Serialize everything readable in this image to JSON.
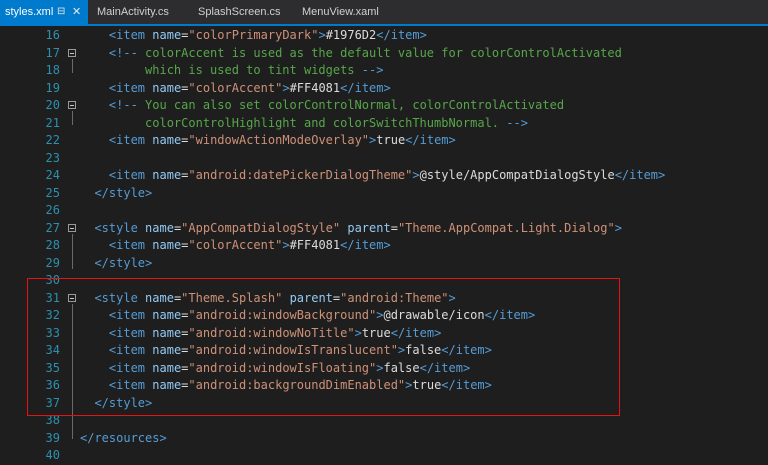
{
  "tabs": [
    {
      "label": "styles.xml",
      "active": true,
      "pin_glyph": "⊟",
      "close_glyph": "✕"
    },
    {
      "label": "MainActivity.cs",
      "active": false
    },
    {
      "label": "SplashScreen.cs",
      "active": false
    },
    {
      "label": "MenuView.xaml",
      "active": false
    }
  ],
  "colors": {
    "background": "#1e1e1e",
    "tab_active": "#007acc",
    "line_number": "#2b91af",
    "tag": "#569cd6",
    "attribute": "#92caf4",
    "value": "#ce9178",
    "comment": "#57a64a",
    "text": "#dcdcdc",
    "highlight_border": "#e51414"
  },
  "editor": {
    "lines": [
      {
        "num": "16",
        "fold": false,
        "tokens": [
          [
            "t",
            "    "
          ],
          [
            "p",
            "<item "
          ],
          [
            "a",
            "name"
          ],
          [
            "t",
            "="
          ],
          [
            "s",
            "\"colorPrimaryDark\""
          ],
          [
            "p",
            ">"
          ],
          [
            "t",
            "#1976D2"
          ],
          [
            "p",
            "</item>"
          ]
        ]
      },
      {
        "num": "17",
        "fold": true,
        "tokens": [
          [
            "t",
            "    "
          ],
          [
            "p",
            "<!-- "
          ],
          [
            "c",
            "colorAccent is used as the default value for colorControlActivated"
          ]
        ]
      },
      {
        "num": "18",
        "fold": false,
        "tokens": [
          [
            "c",
            "         which is used to tint widgets "
          ],
          [
            "p",
            "-->"
          ]
        ]
      },
      {
        "num": "19",
        "fold": false,
        "tokens": [
          [
            "t",
            "    "
          ],
          [
            "p",
            "<item "
          ],
          [
            "a",
            "name"
          ],
          [
            "t",
            "="
          ],
          [
            "s",
            "\"colorAccent\""
          ],
          [
            "p",
            ">"
          ],
          [
            "t",
            "#FF4081"
          ],
          [
            "p",
            "</item>"
          ]
        ]
      },
      {
        "num": "20",
        "fold": true,
        "tokens": [
          [
            "t",
            "    "
          ],
          [
            "p",
            "<!-- "
          ],
          [
            "c",
            "You can also set colorControlNormal, colorControlActivated"
          ]
        ]
      },
      {
        "num": "21",
        "fold": false,
        "tokens": [
          [
            "c",
            "         colorControlHighlight and colorSwitchThumbNormal. "
          ],
          [
            "p",
            "-->"
          ]
        ]
      },
      {
        "num": "22",
        "fold": false,
        "tokens": [
          [
            "t",
            "    "
          ],
          [
            "p",
            "<item "
          ],
          [
            "a",
            "name"
          ],
          [
            "t",
            "="
          ],
          [
            "s",
            "\"windowActionModeOverlay\""
          ],
          [
            "p",
            ">"
          ],
          [
            "t",
            "true"
          ],
          [
            "p",
            "</item>"
          ]
        ]
      },
      {
        "num": "23",
        "fold": false,
        "tokens": []
      },
      {
        "num": "24",
        "fold": false,
        "tokens": [
          [
            "t",
            "    "
          ],
          [
            "p",
            "<item "
          ],
          [
            "a",
            "name"
          ],
          [
            "t",
            "="
          ],
          [
            "s",
            "\"android:datePickerDialogTheme\""
          ],
          [
            "p",
            ">"
          ],
          [
            "t",
            "@style/AppCompatDialogStyle"
          ],
          [
            "p",
            "</item>"
          ]
        ]
      },
      {
        "num": "25",
        "fold": false,
        "tokens": [
          [
            "t",
            "  "
          ],
          [
            "p",
            "</style>"
          ]
        ]
      },
      {
        "num": "26",
        "fold": false,
        "tokens": []
      },
      {
        "num": "27",
        "fold": true,
        "tokens": [
          [
            "t",
            "  "
          ],
          [
            "p",
            "<style "
          ],
          [
            "a",
            "name"
          ],
          [
            "t",
            "="
          ],
          [
            "s",
            "\"AppCompatDialogStyle\""
          ],
          [
            "t",
            " "
          ],
          [
            "a",
            "parent"
          ],
          [
            "t",
            "="
          ],
          [
            "s",
            "\"Theme.AppCompat.Light.Dialog\""
          ],
          [
            "p",
            ">"
          ]
        ]
      },
      {
        "num": "28",
        "fold": false,
        "tokens": [
          [
            "t",
            "    "
          ],
          [
            "p",
            "<item "
          ],
          [
            "a",
            "name"
          ],
          [
            "t",
            "="
          ],
          [
            "s",
            "\"colorAccent\""
          ],
          [
            "p",
            ">"
          ],
          [
            "t",
            "#FF4081"
          ],
          [
            "p",
            "</item>"
          ]
        ]
      },
      {
        "num": "29",
        "fold": false,
        "tokens": [
          [
            "t",
            "  "
          ],
          [
            "p",
            "</style>"
          ]
        ]
      },
      {
        "num": "30",
        "fold": false,
        "tokens": []
      },
      {
        "num": "31",
        "fold": true,
        "tokens": [
          [
            "t",
            "  "
          ],
          [
            "p",
            "<style "
          ],
          [
            "a",
            "name"
          ],
          [
            "t",
            "="
          ],
          [
            "s",
            "\"Theme.Splash\""
          ],
          [
            "t",
            " "
          ],
          [
            "a",
            "parent"
          ],
          [
            "t",
            "="
          ],
          [
            "s",
            "\"android:Theme\""
          ],
          [
            "p",
            ">"
          ]
        ]
      },
      {
        "num": "32",
        "fold": false,
        "tokens": [
          [
            "t",
            "    "
          ],
          [
            "p",
            "<item "
          ],
          [
            "a",
            "name"
          ],
          [
            "t",
            "="
          ],
          [
            "s",
            "\"android:windowBackground\""
          ],
          [
            "p",
            ">"
          ],
          [
            "t",
            "@drawable/icon"
          ],
          [
            "p",
            "</item>"
          ]
        ]
      },
      {
        "num": "33",
        "fold": false,
        "tokens": [
          [
            "t",
            "    "
          ],
          [
            "p",
            "<item "
          ],
          [
            "a",
            "name"
          ],
          [
            "t",
            "="
          ],
          [
            "s",
            "\"android:windowNoTitle\""
          ],
          [
            "p",
            ">"
          ],
          [
            "t",
            "true"
          ],
          [
            "p",
            "</item>"
          ]
        ]
      },
      {
        "num": "34",
        "fold": false,
        "tokens": [
          [
            "t",
            "    "
          ],
          [
            "p",
            "<item "
          ],
          [
            "a",
            "name"
          ],
          [
            "t",
            "="
          ],
          [
            "s",
            "\"android:windowIsTranslucent\""
          ],
          [
            "p",
            ">"
          ],
          [
            "t",
            "false"
          ],
          [
            "p",
            "</item>"
          ]
        ]
      },
      {
        "num": "35",
        "fold": false,
        "tokens": [
          [
            "t",
            "    "
          ],
          [
            "p",
            "<item "
          ],
          [
            "a",
            "name"
          ],
          [
            "t",
            "="
          ],
          [
            "s",
            "\"android:windowIsFloating\""
          ],
          [
            "p",
            ">"
          ],
          [
            "t",
            "false"
          ],
          [
            "p",
            "</item>"
          ]
        ]
      },
      {
        "num": "36",
        "fold": false,
        "tokens": [
          [
            "t",
            "    "
          ],
          [
            "p",
            "<item "
          ],
          [
            "a",
            "name"
          ],
          [
            "t",
            "="
          ],
          [
            "s",
            "\"android:backgroundDimEnabled\""
          ],
          [
            "p",
            ">"
          ],
          [
            "t",
            "true"
          ],
          [
            "p",
            "</item>"
          ]
        ]
      },
      {
        "num": "37",
        "fold": false,
        "tokens": [
          [
            "t",
            "  "
          ],
          [
            "p",
            "</style>"
          ]
        ]
      },
      {
        "num": "38",
        "fold": false,
        "tokens": []
      },
      {
        "num": "39",
        "fold": false,
        "tokens": [
          [
            "p",
            "</resources>"
          ]
        ]
      },
      {
        "num": "40",
        "fold": false,
        "tokens": []
      }
    ]
  }
}
